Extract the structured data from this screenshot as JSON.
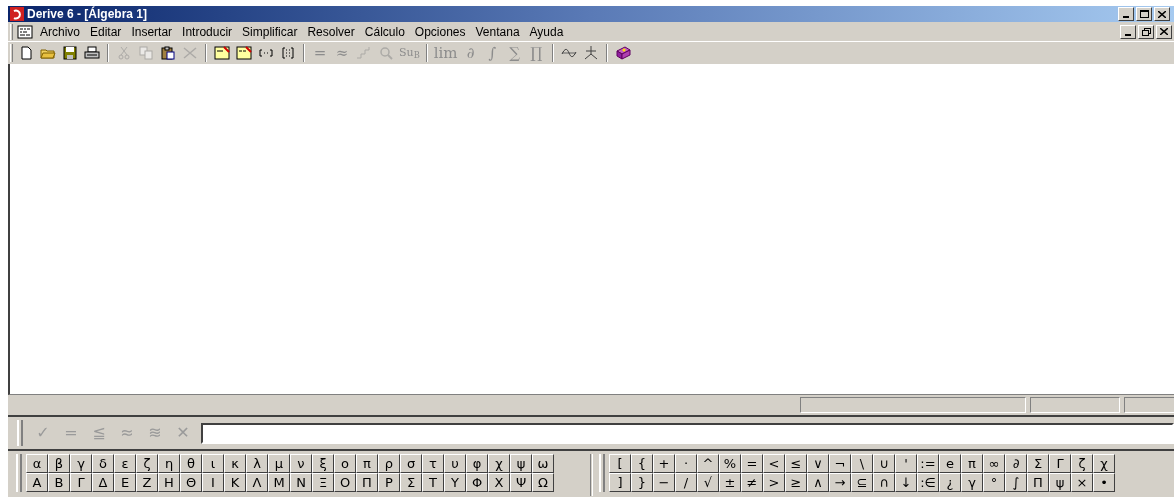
{
  "window": {
    "title": "Derive 6 - [Álgebra 1]"
  },
  "menu": [
    {
      "label": "Archivo"
    },
    {
      "label": "Editar"
    },
    {
      "label": "Insertar"
    },
    {
      "label": "Introducir"
    },
    {
      "label": "Simplificar"
    },
    {
      "label": "Resolver"
    },
    {
      "label": "Cálculo"
    },
    {
      "label": "Opciones"
    },
    {
      "label": "Ventana"
    },
    {
      "label": "Ayuda"
    }
  ],
  "toolbar": [
    [
      {
        "kind": "new",
        "disabled": false
      },
      {
        "kind": "open",
        "disabled": false
      },
      {
        "kind": "save",
        "disabled": false
      },
      {
        "kind": "print",
        "disabled": false
      }
    ],
    [
      {
        "kind": "cut",
        "disabled": true
      },
      {
        "kind": "copy",
        "disabled": true
      },
      {
        "kind": "paste",
        "disabled": false
      },
      {
        "kind": "delete",
        "disabled": true
      }
    ],
    [
      {
        "kind": "author",
        "disabled": false
      },
      {
        "kind": "author-vector",
        "disabled": false
      },
      {
        "kind": "vector",
        "disabled": false
      },
      {
        "kind": "matrix",
        "disabled": false
      }
    ],
    [
      {
        "kind": "glyph",
        "text": "=",
        "disabled": true
      },
      {
        "kind": "glyph",
        "text": "≈",
        "disabled": true
      },
      {
        "kind": "steps",
        "disabled": true
      },
      {
        "kind": "find",
        "disabled": true
      },
      {
        "kind": "sub",
        "text": "Su",
        "sub": "B",
        "disabled": true
      }
    ],
    [
      {
        "kind": "glyph",
        "text": "lim",
        "disabled": true
      },
      {
        "kind": "glyph",
        "text": "∂",
        "disabled": true
      },
      {
        "kind": "glyph",
        "text": "∫",
        "disabled": true
      },
      {
        "kind": "glyph",
        "text": "∑",
        "disabled": true
      },
      {
        "kind": "glyph",
        "text": "∏",
        "disabled": true
      }
    ],
    [
      {
        "kind": "plot2d",
        "disabled": false
      },
      {
        "kind": "plot3d",
        "disabled": false
      }
    ],
    [
      {
        "kind": "help",
        "disabled": false
      }
    ]
  ],
  "entry_bar": {
    "buttons": [
      {
        "text": "✓",
        "disabled": true
      },
      {
        "text": "=",
        "disabled": true
      },
      {
        "text": "≦",
        "disabled": true
      },
      {
        "text": "≈",
        "disabled": true
      },
      {
        "text": "≋",
        "disabled": true
      },
      {
        "text": "✕",
        "disabled": true
      }
    ]
  },
  "greek_palette": [
    [
      "α",
      "β",
      "γ",
      "δ",
      "ε",
      "ζ",
      "η",
      "θ",
      "ι",
      "κ",
      "λ",
      "μ",
      "ν",
      "ξ",
      "ο",
      "π",
      "ρ",
      "σ",
      "τ",
      "υ",
      "φ",
      "χ",
      "ψ",
      "ω"
    ],
    [
      "Α",
      "Β",
      "Γ",
      "Δ",
      "Ε",
      "Ζ",
      "Η",
      "Θ",
      "Ι",
      "Κ",
      "Λ",
      "Μ",
      "Ν",
      "Ξ",
      "Ο",
      "Π",
      "Ρ",
      "Σ",
      "Τ",
      "Υ",
      "Φ",
      "Χ",
      "Ψ",
      "Ω"
    ]
  ],
  "math_palette": [
    [
      "[",
      "{",
      "+",
      "·",
      "^",
      "%",
      "=",
      "<",
      "≤",
      "∨",
      "¬",
      "\\",
      "∪",
      "'",
      ":=",
      "e",
      "π",
      "∞",
      "∂",
      "Σ",
      "Γ",
      "ζ",
      "χ"
    ],
    [
      "]",
      "}",
      "−",
      "/",
      "√",
      "±",
      "≠",
      ">",
      "≥",
      "∧",
      "→",
      "⊆",
      "∩",
      "↓",
      ":∈",
      "¿",
      "γ",
      "°",
      "∫",
      "Π",
      "ψ",
      "×",
      "•"
    ]
  ]
}
